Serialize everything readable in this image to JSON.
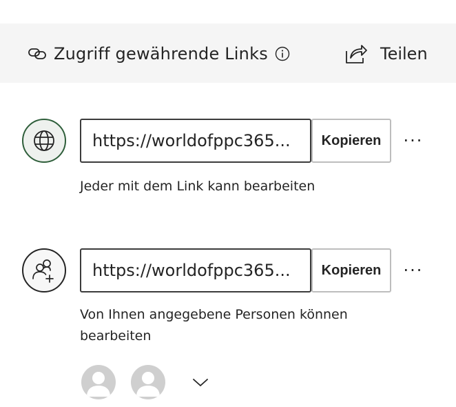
{
  "header": {
    "title": "Zugriff gewährende Links",
    "share_label": "Teilen",
    "link_icon": "link-icon",
    "info_icon": "info-icon",
    "share_icon": "share-icon"
  },
  "links": [
    {
      "icon": "globe-icon",
      "url": "https://worldofppc365...",
      "copy_label": "Kopieren",
      "more_label": "···",
      "description": "Jeder mit dem Link kann bearbeiten"
    },
    {
      "icon": "people-add-icon",
      "url": "https://worldofppc365...",
      "copy_label": "Kopieren",
      "more_label": "···",
      "description": "Von Ihnen angegebene Personen können bearbeiten"
    }
  ],
  "colors": {
    "header_bg": "#f5f5f5",
    "globe_border": "#2e5e3a",
    "text": "#242424"
  }
}
